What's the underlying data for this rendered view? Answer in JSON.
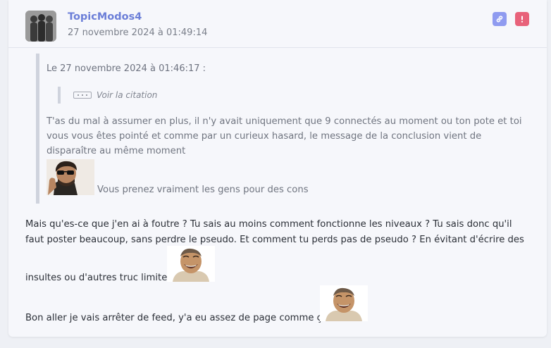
{
  "post": {
    "author": "TopicModos4",
    "date": "27 novembre 2024 à 01:49:14",
    "icons": {
      "link": "link-icon",
      "report": "exclamation-icon"
    },
    "colors": {
      "author": "#6c7fd8",
      "link_button": "#8f9bf0",
      "report_button": "#e8627a"
    }
  },
  "quote": {
    "header": "Le 27 novembre 2024 à 01:46:17 :",
    "nested_quote_label": "Voir la citation",
    "text": "T'as du mal à assumer en plus, il n'y avait uniquement que 9 connectés au moment ou ton pote et toi vous vous êtes pointé et comme par un curieux hasard, le message de la conclusion vient de disparaître au même moment",
    "caption": "Vous prenez vraiment les gens pour des cons"
  },
  "message": {
    "paragraph1": "Mais qu'es-ce que j'en ai à foutre ? Tu sais au moins comment fonctionne les niveaux ? Tu sais donc qu'il faut poster beaucoup, sans perdre le pseudo. Et comment tu perds pas de pseudo ? En évitant d'écrire des",
    "paragraph2": "insultes ou d'autres truc limite",
    "paragraph3": "Bon aller je vais arrêter de feed, y'a eu assez de page comme ça"
  }
}
